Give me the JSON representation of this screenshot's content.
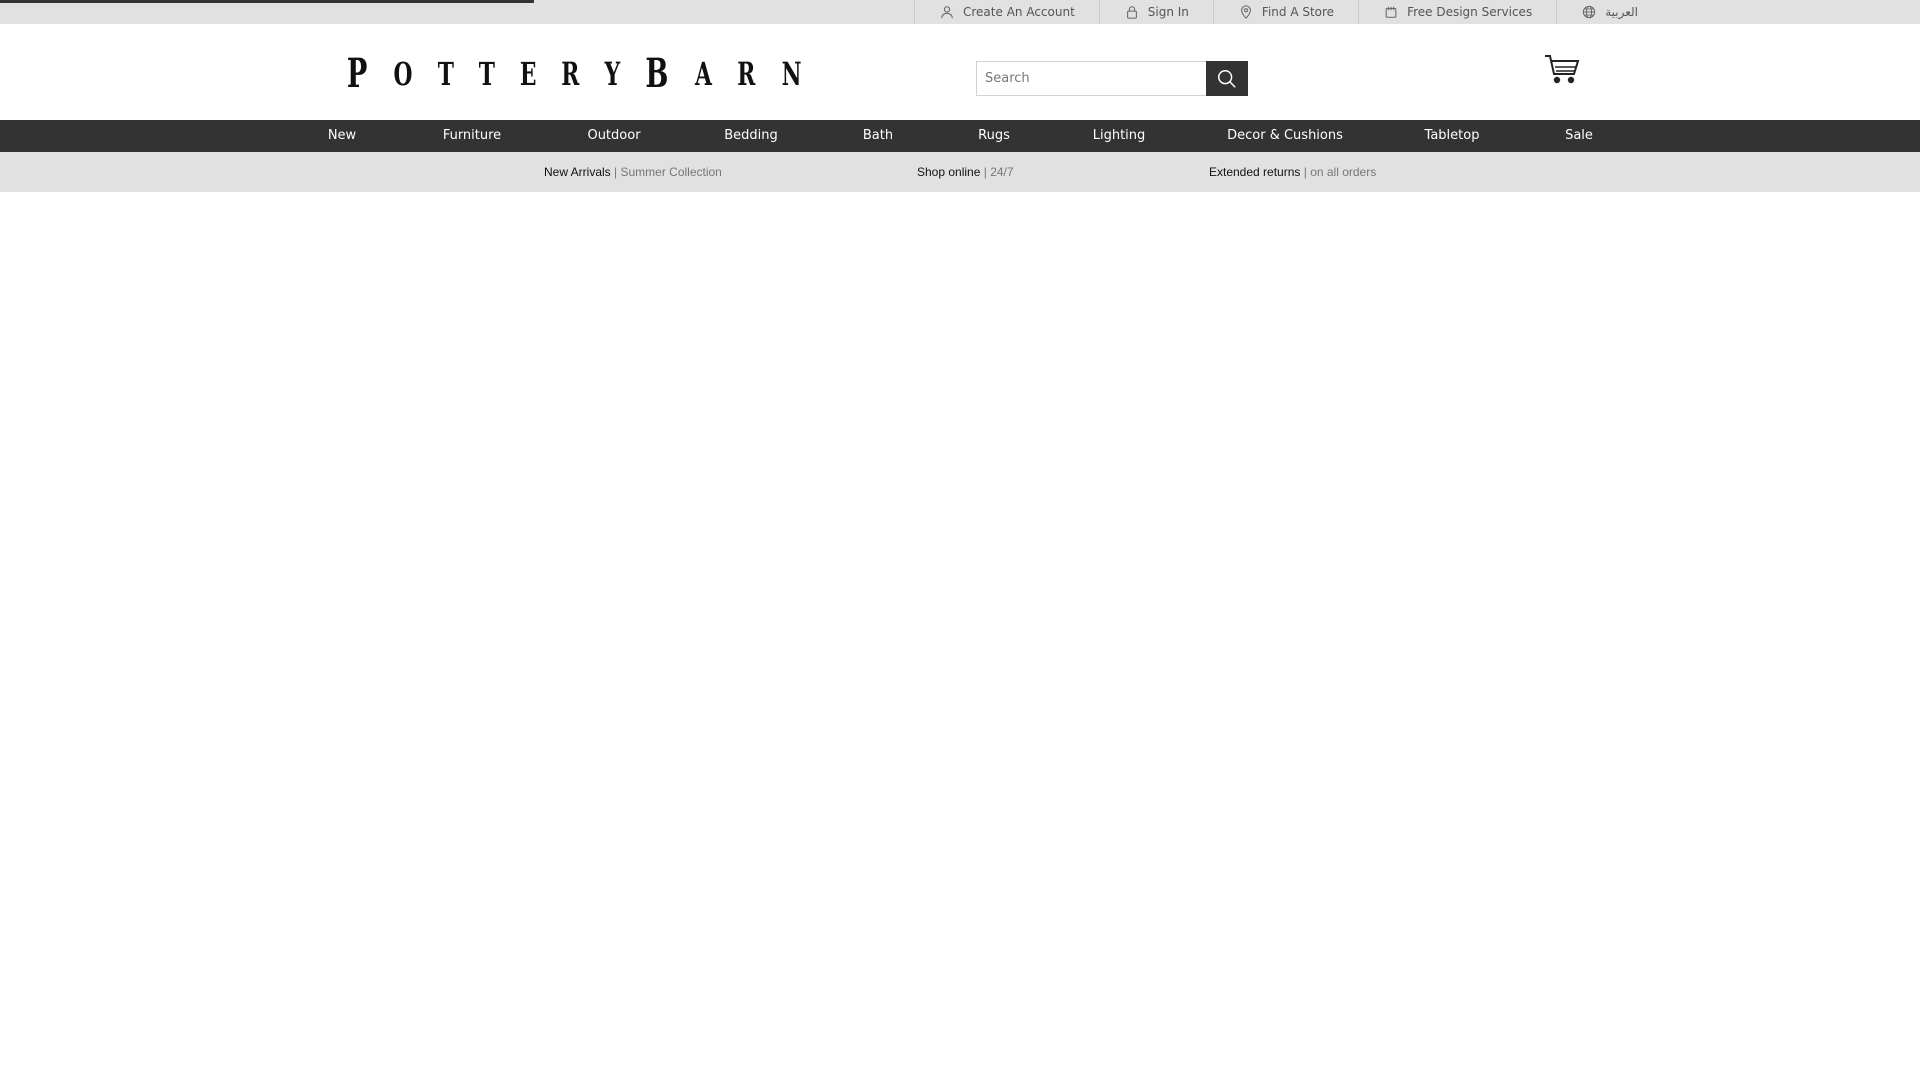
{
  "loading": {
    "progress_percent": 27.8
  },
  "utility_links": [
    {
      "label": "Create An Account",
      "icon": "user-icon"
    },
    {
      "label": "Sign In",
      "icon": "lock-icon"
    },
    {
      "label": "Find A Store",
      "icon": "map-pin-icon"
    },
    {
      "label": "Free Design Services",
      "icon": "design-services-icon"
    },
    {
      "label": "العربية",
      "icon": "globe-icon"
    }
  ],
  "header": {
    "logo_text": "POTTERYBARN",
    "search": {
      "placeholder": "Search",
      "value": ""
    },
    "cart_icon": "cart-icon"
  },
  "nav": {
    "items": [
      {
        "label": "New"
      },
      {
        "label": "Furniture"
      },
      {
        "label": "Outdoor"
      },
      {
        "label": "Bedding"
      },
      {
        "label": "Bath"
      },
      {
        "label": "Rugs"
      },
      {
        "label": "Lighting"
      },
      {
        "label": "Decor & Cushions"
      },
      {
        "label": "Tabletop"
      },
      {
        "label": "Sale"
      }
    ]
  },
  "promos": [
    {
      "strong": "New Arrivals",
      "sep": " | ",
      "light": "Summer Collection"
    },
    {
      "strong": "Shop online",
      "sep": " | ",
      "light": "24/7"
    },
    {
      "strong": "Extended returns",
      "sep": " | ",
      "light": "on all orders"
    }
  ],
  "colors": {
    "utility_bar_bg": "#e1e1e1",
    "nav_bg": "#333333",
    "nav_text": "#ffffff",
    "promo_bar_bg": "#e1e1e1"
  }
}
